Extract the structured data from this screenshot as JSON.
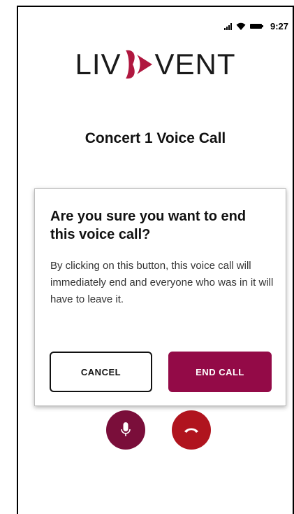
{
  "status_bar": {
    "time": "9:27",
    "icons": [
      "signal-icon",
      "wifi-icon",
      "battery-icon"
    ]
  },
  "logo": {
    "left_text": "LIV",
    "right_text": "VENT",
    "mark_color": "#b0173f"
  },
  "screen": {
    "title": "Concert 1 Voice Call"
  },
  "dialog": {
    "title": "Are you sure you want to end this voice call?",
    "body": "By clicking on this button, this voice call will immediately end and everyone who was in it will have to leave it.",
    "cancel_label": "CANCEL",
    "confirm_label": "END CALL"
  },
  "controls": {
    "mic_icon": "microphone-icon",
    "hangup_icon": "phone-hangup-icon"
  },
  "colors": {
    "brand": "#930a47",
    "mic_button": "#7a0e3a",
    "hangup_button": "#b0141e"
  }
}
